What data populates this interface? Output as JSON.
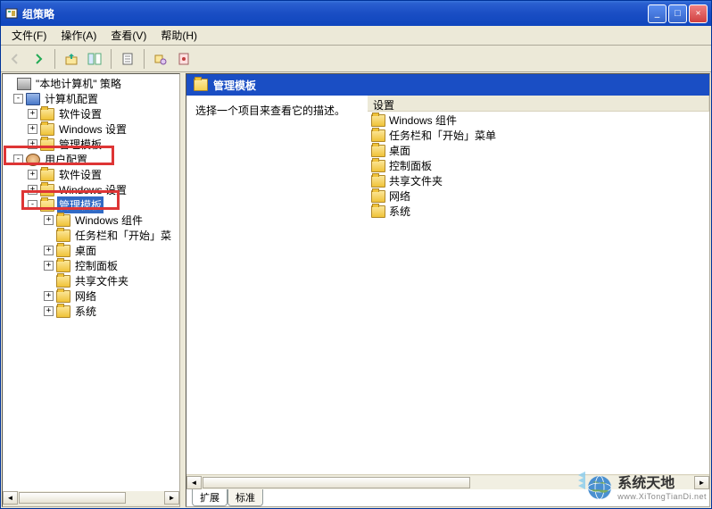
{
  "window": {
    "title": "组策略"
  },
  "menu": {
    "file": "文件(F)",
    "action": "操作(A)",
    "view": "查看(V)",
    "help": "帮助(H)"
  },
  "tree": {
    "root": "\"本地计算机\" 策略",
    "computer_config": "计算机配置",
    "software_settings_1": "软件设置",
    "windows_settings_1": "Windows 设置",
    "admin_templates_1": "管理模板",
    "user_config": "用户配置",
    "software_settings_2": "软件设置",
    "windows_settings_2": "Windows 设置",
    "admin_templates_2": "管理模板",
    "windows_components": "Windows 组件",
    "taskbar_start": "任务栏和「开始」菜",
    "desktop": "桌面",
    "control_panel": "控制面板",
    "shared_folders": "共享文件夹",
    "network": "网络",
    "system": "系统"
  },
  "right": {
    "header": "管理模板",
    "description": "选择一个项目来查看它的描述。",
    "column_header": "设置",
    "items": [
      "Windows 组件",
      "任务栏和「开始」菜单",
      "桌面",
      "控制面板",
      "共享文件夹",
      "网络",
      "系统"
    ]
  },
  "tabs": {
    "extended": "扩展",
    "standard": "标准"
  },
  "watermark": {
    "cn": "系统天地",
    "en": "www.XiTongTianDi.net"
  }
}
